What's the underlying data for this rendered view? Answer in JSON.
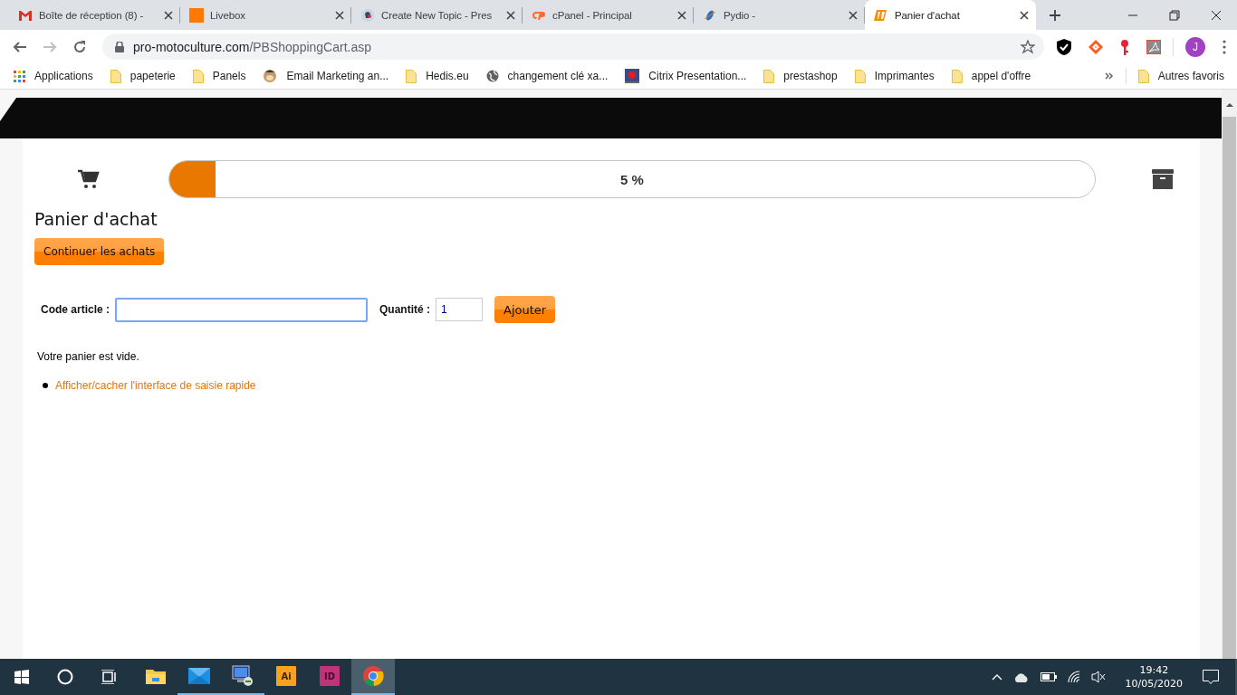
{
  "browser": {
    "tabs": [
      {
        "title": "Boîte de réception (8) -",
        "kind": "gmail",
        "selected": false
      },
      {
        "title": "Livebox",
        "kind": "orange",
        "selected": false
      },
      {
        "title": "Create New Topic - Pres",
        "kind": "parrot",
        "selected": false
      },
      {
        "title": "cPanel - Principal",
        "kind": "cpanel",
        "selected": false
      },
      {
        "title": "Pydio -",
        "kind": "pydio",
        "selected": false
      },
      {
        "title": "Panier d'achat",
        "kind": "pm",
        "selected": true
      }
    ],
    "url": {
      "host": "pro-motoculture.com",
      "path": "/PBShoppingCart.asp"
    },
    "profile_initial": "J",
    "bookmarks": [
      {
        "label": "Applications",
        "kind": "apps"
      },
      {
        "label": "papeterie",
        "kind": "folder"
      },
      {
        "label": "Panels",
        "kind": "folder"
      },
      {
        "label": "Email Marketing an...",
        "kind": "chimp"
      },
      {
        "label": "Hedis.eu",
        "kind": "folder"
      },
      {
        "label": "changement clé xa...",
        "kind": "globe"
      },
      {
        "label": "Citrix Presentation...",
        "kind": "citrix"
      },
      {
        "label": "prestashop",
        "kind": "folder"
      },
      {
        "label": "Imprimantes",
        "kind": "folder"
      },
      {
        "label": "appel d'offre",
        "kind": "folder"
      }
    ],
    "other_bookmarks": "Autres favoris"
  },
  "page": {
    "progress": {
      "level": 0.05,
      "reading": "5 %"
    },
    "title": "Panier d'achat",
    "continue_button": "Continuer les achats",
    "form": {
      "code_label": "Code article :",
      "code_focused": true,
      "quantity_label": "Quantité :",
      "quantity_value": "1",
      "add_button": "Ajouter"
    },
    "message": "Votre panier est vide.",
    "links": [
      "Afficher/cacher l'interface de saisie rapide"
    ]
  },
  "taskbar": {
    "apps": [
      {
        "kind": "explorer",
        "running": false,
        "selected": false
      },
      {
        "kind": "mail",
        "running": true,
        "selected": false
      },
      {
        "kind": "remote",
        "running": true,
        "selected": false
      },
      {
        "kind": "illustrator",
        "label": "Ai",
        "running": false,
        "selected": false
      },
      {
        "kind": "indesign",
        "label": "ID",
        "running": false,
        "selected": false
      },
      {
        "kind": "chrome",
        "running": true,
        "selected": true
      }
    ],
    "time": "19:42",
    "date": "10/05/2020"
  }
}
